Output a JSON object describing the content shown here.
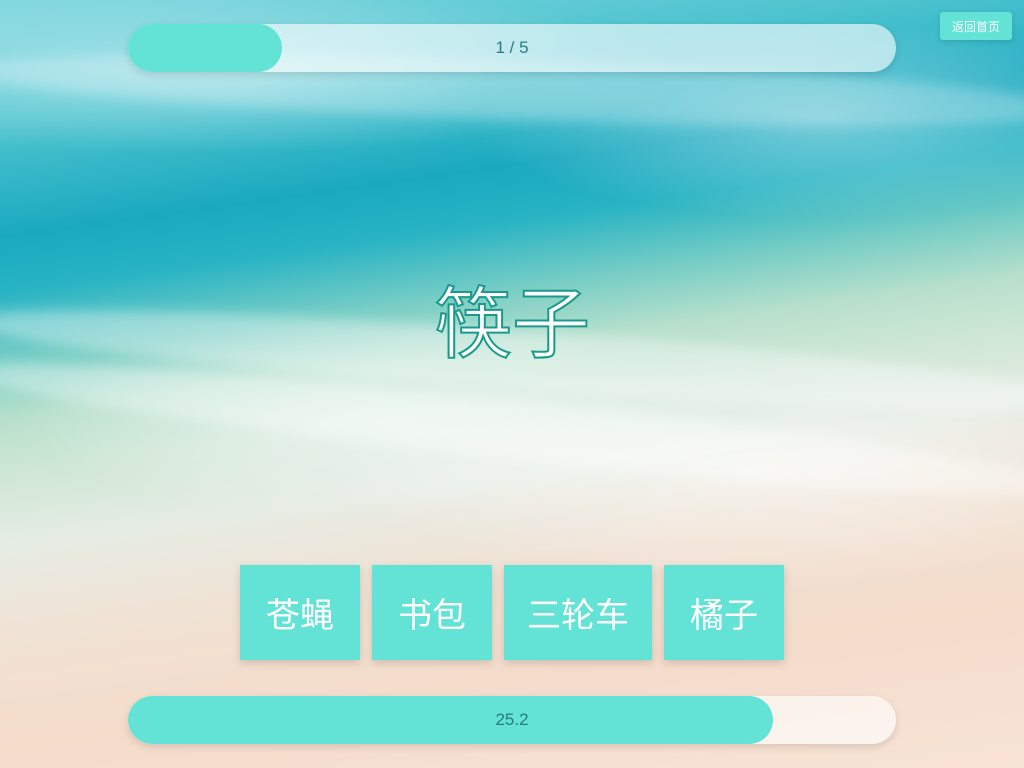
{
  "header": {
    "question_progress_text": "1 / 5",
    "question_progress_fraction": 0.2,
    "home_button_label": "返回首页"
  },
  "prompt": {
    "word": "筷子"
  },
  "choices": [
    {
      "label": "苍蝇"
    },
    {
      "label": "书包"
    },
    {
      "label": "三轮车"
    },
    {
      "label": "橘子"
    }
  ],
  "timer": {
    "value_text": "25.2",
    "remaining_fraction": 0.84
  },
  "colors": {
    "accent": "#63e2d6",
    "word_outline": "#1a9a8e",
    "progress_text": "#2a7a80"
  }
}
